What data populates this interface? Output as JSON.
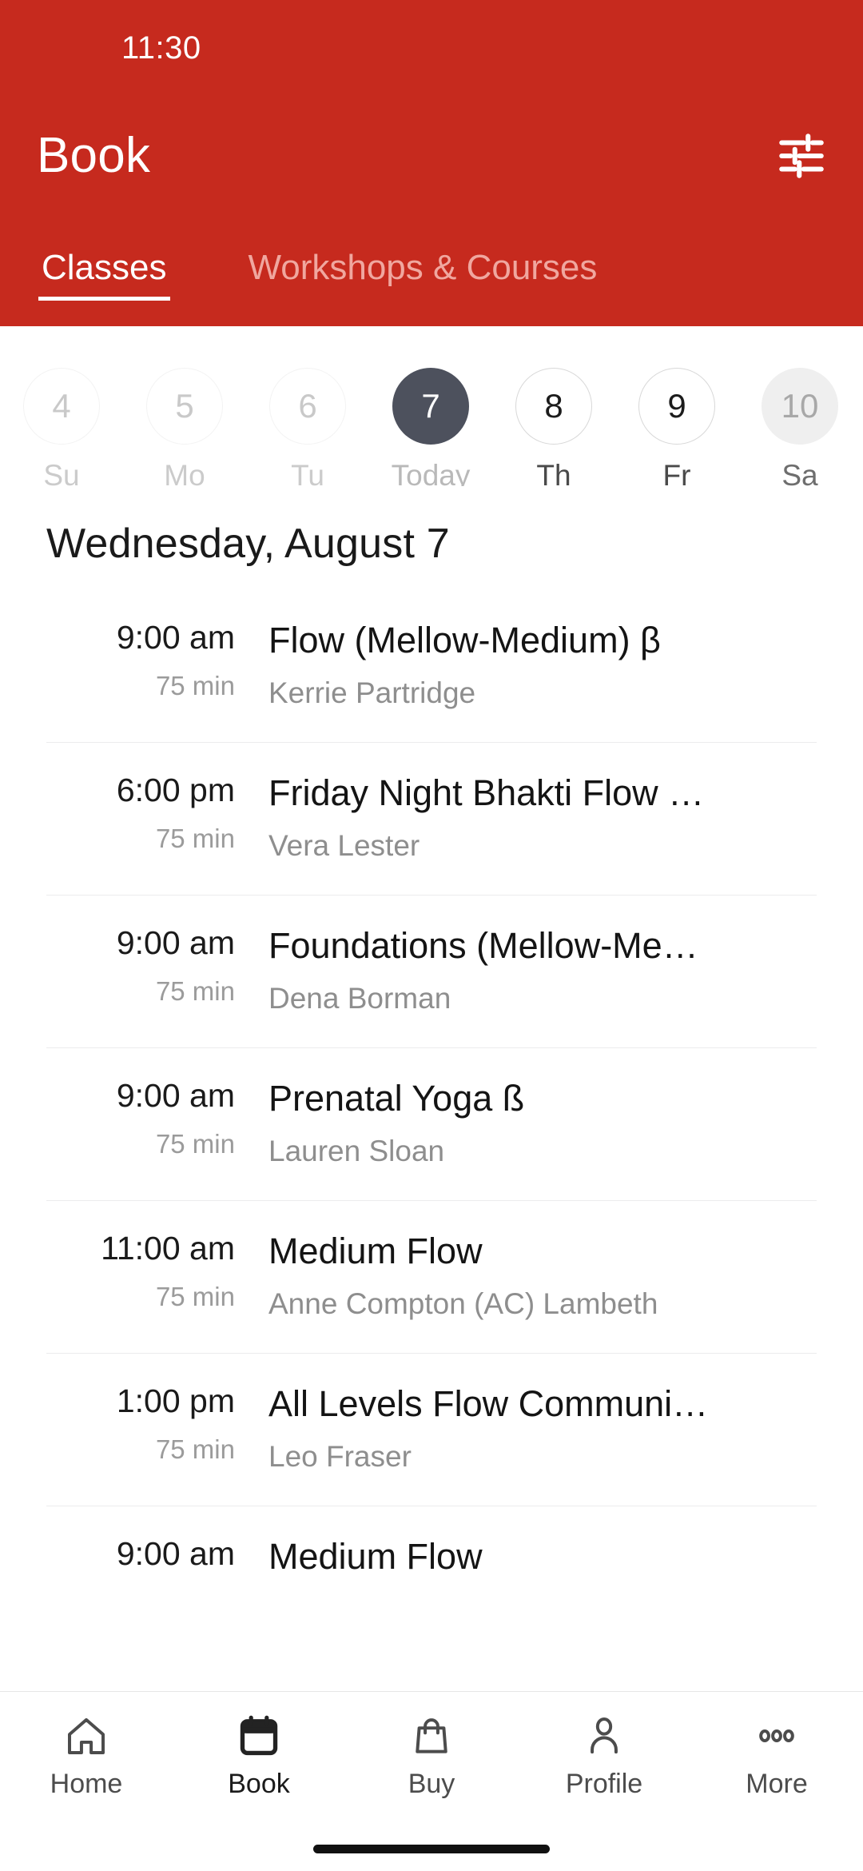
{
  "colors": {
    "brand_red": "#c62a1e",
    "selected_day": "#4d515d",
    "text_primary": "#141414",
    "text_muted": "#8e8e8e"
  },
  "status_bar": {
    "time": "11:30"
  },
  "header": {
    "title": "Book",
    "filter_icon": "tune-sliders-icon",
    "tabs": [
      {
        "label": "Classes",
        "active": true
      },
      {
        "label": "Workshops & Courses",
        "active": false
      }
    ]
  },
  "date_strip": {
    "days": [
      {
        "date": "4",
        "label": "Su",
        "state": "past"
      },
      {
        "date": "5",
        "label": "Mo",
        "state": "past"
      },
      {
        "date": "6",
        "label": "Tu",
        "state": "past"
      },
      {
        "date": "7",
        "label": "Today",
        "state": "today"
      },
      {
        "date": "8",
        "label": "Th",
        "state": "future"
      },
      {
        "date": "9",
        "label": "Fr",
        "state": "future"
      },
      {
        "date": "10",
        "label": "Sa",
        "state": "edge"
      }
    ]
  },
  "schedule": {
    "heading": "Wednesday, August 7",
    "classes": [
      {
        "time": "9:00 am",
        "duration": "75 min",
        "name": "Flow (Mellow-Medium) β",
        "teacher": "Kerrie Partridge"
      },
      {
        "time": "6:00 pm",
        "duration": "75 min",
        "name": "Friday Night Bhakti Flow …",
        "teacher": "Vera Lester"
      },
      {
        "time": "9:00 am",
        "duration": "75 min",
        "name": "Foundations (Mellow-Me…",
        "teacher": "Dena Borman"
      },
      {
        "time": "9:00 am",
        "duration": "75 min",
        "name": "Prenatal Yoga ß",
        "teacher": "Lauren Sloan"
      },
      {
        "time": "11:00 am",
        "duration": "75 min",
        "name": "Medium Flow",
        "teacher": "Anne Compton (AC) Lambeth"
      },
      {
        "time": "1:00 pm",
        "duration": "75 min",
        "name": "All Levels Flow Communi…",
        "teacher": "Leo Fraser"
      },
      {
        "time": "9:00 am",
        "duration": "",
        "name": "Medium Flow",
        "teacher": ""
      }
    ]
  },
  "bottom_nav": {
    "items": [
      {
        "label": "Home",
        "icon": "home-icon",
        "active": false
      },
      {
        "label": "Book",
        "icon": "calendar-icon",
        "active": true
      },
      {
        "label": "Buy",
        "icon": "shopping-bag-icon",
        "active": false
      },
      {
        "label": "Profile",
        "icon": "person-icon",
        "active": false
      },
      {
        "label": "More",
        "icon": "more-dots-icon",
        "active": false
      }
    ]
  }
}
